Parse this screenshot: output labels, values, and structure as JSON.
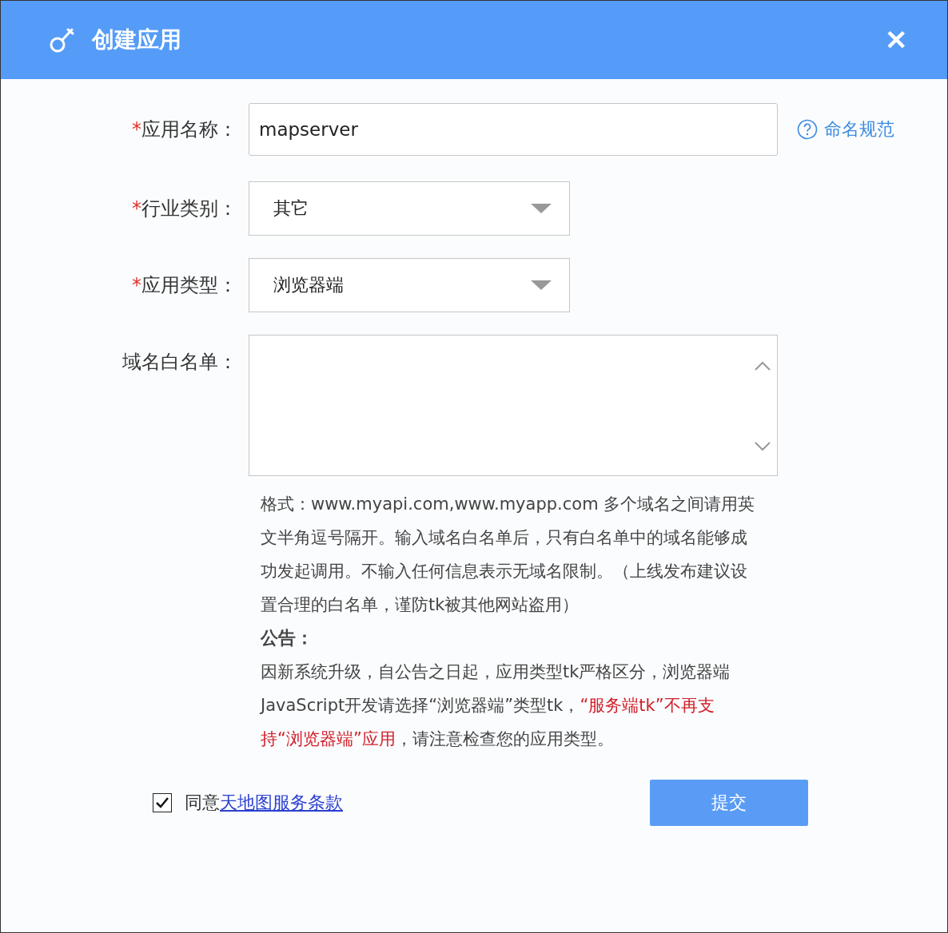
{
  "window": {
    "title": "创建应用",
    "close": "✕"
  },
  "fields": [
    {
      "kind": "text",
      "marker": "*",
      "label": "应用名称：",
      "value": "mapserver",
      "help": "命名规范"
    },
    {
      "kind": "select",
      "marker": "*",
      "label": "行业类别：",
      "value": "其它"
    },
    {
      "kind": "select",
      "marker": "*",
      "label": "应用类型：",
      "value": "浏览器端"
    },
    {
      "kind": "textarea",
      "label": "域名白名单："
    }
  ],
  "hint": "格式：www.myapi.com,www.myapp.com 多个域名之间请用英文半角逗号隔开。输入域名白名单后，只有白名单中的域名能够成功发起调用。不输入任何信息表示无域名限制。（上线发布建议设置合理的白名单，谨防tk被其他网站盗用）",
  "notice": {
    "title": "公告：",
    "segments": [
      {
        "text": "因新系统升级，自公告之日起，应用类型tk严格区分，浏览器端JavaScript开发请选择“浏览器端”类型tk，",
        "highlight": false
      },
      {
        "text": "“服务端tk”不再支持“浏览器端”应用",
        "highlight": true
      },
      {
        "text": "，请注意检查您的应用类型。",
        "highlight": false
      }
    ]
  },
  "agreement": {
    "checked": true,
    "label": "同意",
    "link": "天地图服务条款"
  },
  "submit": "提交"
}
